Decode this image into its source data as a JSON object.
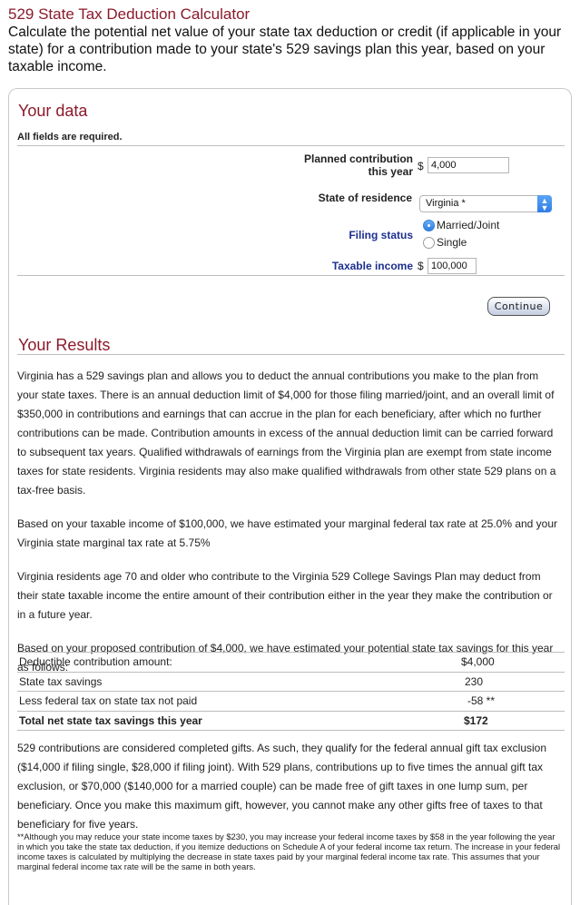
{
  "header": {
    "title": "529 State Tax Deduction Calculator",
    "description": "Calculate the potential net value of your state tax deduction or credit (if applicable in your state) for a contribution made to your state's 529 savings plan this year, based on your taxable income."
  },
  "form": {
    "section_title": "Your data",
    "required_note": "All fields are required.",
    "contribution": {
      "label_line1": "Planned contribution",
      "label_line2": "this year",
      "currency": "$",
      "value": "4,000"
    },
    "state": {
      "label": "State of residence",
      "selected": "Virginia *",
      "icon": "select-stepper-icon"
    },
    "filing_status": {
      "label": "Filing status",
      "options": [
        {
          "label": "Married/Joint",
          "checked": true
        },
        {
          "label": "Single",
          "checked": false
        }
      ]
    },
    "income": {
      "label": "Taxable income",
      "currency": "$",
      "value": "100,000"
    },
    "continue_label": "Continue"
  },
  "results": {
    "section_title": "Your Results",
    "paragraphs": [
      "Virginia has a 529 savings plan and allows you to deduct the annual contributions you make to the plan from your state taxes. There is an annual deduction limit of $4,000 for those filing married/joint, and an overall limit of $350,000 in contributions and earnings that can accrue in the plan for each beneficiary, after which no further contributions can be made. Contribution amounts in excess of the annual deduction limit can be carried forward to subsequent tax years. Qualified withdrawals of earnings from the Virginia plan are exempt from state income taxes for state residents. Virginia residents may also make qualified withdrawals from other state 529 plans on a tax-free basis.",
      "Based on your taxable income of $100,000, we have estimated your marginal federal tax rate at 25.0% and your Virginia state marginal tax rate at 5.75%",
      "Virginia residents age 70 and older who contribute to the Virginia 529 College Savings Plan may deduct from their state taxable income the entire amount of their contribution either in the year they make the contribution or in a future year.",
      "Based on your proposed contribution of $4,000, we have estimated your potential state tax savings for this year as follows:"
    ],
    "table": [
      {
        "label": "Deductible contribution amount:",
        "value": "$4,000"
      },
      {
        "label": "State tax savings",
        "value": "230"
      },
      {
        "label": "Less federal tax on state tax not paid",
        "value": "-58 **"
      },
      {
        "label": "Total net state tax savings this year",
        "value": "$172"
      }
    ],
    "gift_text": "529 contributions are considered completed gifts. As such, they qualify for the federal annual gift tax exclusion ($14,000 if filing single, $28,000 if filing joint). With 529 plans, contributions up to five times the annual gift tax exclusion, or $70,000 ($140,000 for a married couple) can be made free of gift taxes in one lump sum, per beneficiary. Once you make this maximum gift, however, you cannot make any other gifts free of taxes to that beneficiary for five years.",
    "footnote": "**Although you may reduce your state income taxes by $230, you may increase your federal income taxes by $58 in the year following the year in which you take the state tax deduction, if you itemize deductions on Schedule A of your federal income tax return. The increase in your federal income taxes is calculated by multiplying the decrease in state taxes paid by your marginal federal income tax rate. This assumes that your marginal federal income tax rate will be the same in both years."
  },
  "colors": {
    "accent": "#8b1a2b",
    "label_blue": "#1d2f8f"
  }
}
